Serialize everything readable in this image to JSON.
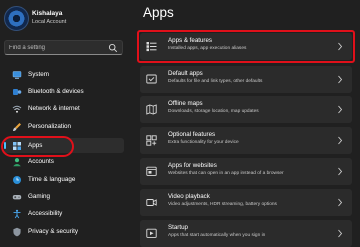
{
  "user": {
    "name": "Kishalaya",
    "account_type": "Local Account"
  },
  "search": {
    "placeholder": "Find a setting"
  },
  "nav": {
    "items": [
      {
        "label": "System",
        "icon": "monitor-icon"
      },
      {
        "label": "Bluetooth & devices",
        "icon": "bluetooth-icon"
      },
      {
        "label": "Network & internet",
        "icon": "wifi-icon"
      },
      {
        "label": "Personalization",
        "icon": "brush-icon"
      },
      {
        "label": "Apps",
        "icon": "apps-icon",
        "selected": true
      },
      {
        "label": "Accounts",
        "icon": "person-icon"
      },
      {
        "label": "Time & language",
        "icon": "clock-globe-icon"
      },
      {
        "label": "Gaming",
        "icon": "gamepad-icon"
      },
      {
        "label": "Accessibility",
        "icon": "accessibility-icon"
      },
      {
        "label": "Privacy & security",
        "icon": "shield-icon"
      }
    ]
  },
  "main": {
    "title": "Apps",
    "cards": [
      {
        "title": "Apps & features",
        "subtitle": "Installed apps, app execution aliases",
        "icon": "apps-list-icon",
        "highlighted": true
      },
      {
        "title": "Default apps",
        "subtitle": "Defaults for file and link types, other defaults",
        "icon": "default-apps-icon"
      },
      {
        "title": "Offline maps",
        "subtitle": "Downloads, storage location, map updates",
        "icon": "map-icon"
      },
      {
        "title": "Optional features",
        "subtitle": "Extra functionality for your device",
        "icon": "optional-features-icon"
      },
      {
        "title": "Apps for websites",
        "subtitle": "Websites that can open in an app instead of a browser",
        "icon": "web-app-icon"
      },
      {
        "title": "Video playback",
        "subtitle": "Video adjustments, HDR streaming, battery options",
        "icon": "video-icon"
      },
      {
        "title": "Startup",
        "subtitle": "Apps that start automatically when you sign in",
        "icon": "startup-icon"
      }
    ]
  },
  "colors": {
    "accent": "#4cc2ff",
    "annotation": "#e0101a",
    "background": "#202020",
    "card": "#2b2b2b"
  }
}
